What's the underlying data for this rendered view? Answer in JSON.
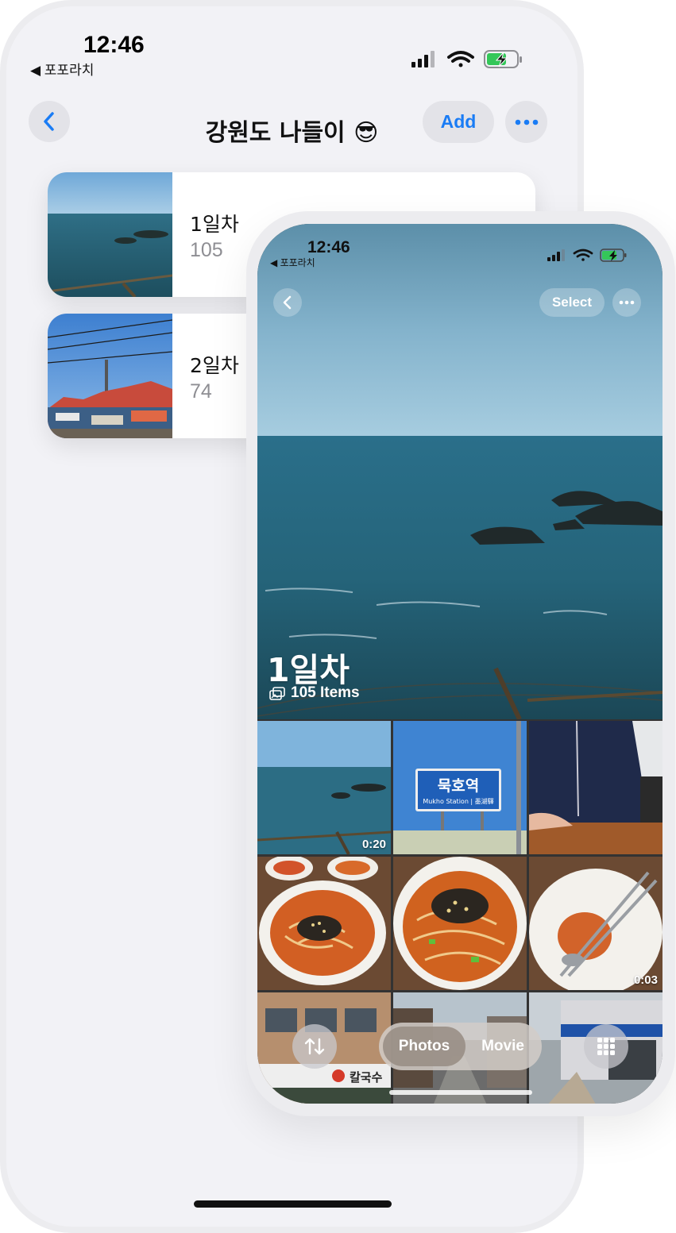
{
  "back_screen": {
    "status": {
      "time": "12:46",
      "back_app": "◀ 포포라치"
    },
    "nav": {
      "title": "강원도 나들이 😎",
      "add_label": "Add"
    },
    "albums": [
      {
        "name": "1일차",
        "count": "105"
      },
      {
        "name": "2일차",
        "count": "74"
      }
    ]
  },
  "front_screen": {
    "status": {
      "time": "12:46",
      "back_app": "◀ 포포라치"
    },
    "nav": {
      "select_label": "Select"
    },
    "hero": {
      "title": "1일차",
      "items": "105 Items"
    },
    "grid": [
      {
        "subject": "sea",
        "duration": "0:20"
      },
      {
        "subject": "station-sign",
        "sign_main": "묵호역",
        "sign_sub": "Mukho Station | 墨湖驛",
        "duration": ""
      },
      {
        "subject": "person-sweater",
        "duration": ""
      },
      {
        "subject": "noodle-soup",
        "duration": ""
      },
      {
        "subject": "noodle-soup",
        "duration": ""
      },
      {
        "subject": "empty-bowl",
        "duration": "0:03"
      },
      {
        "subject": "storefront",
        "sign_text": "칼국수",
        "duration": ""
      },
      {
        "subject": "street",
        "duration": ""
      },
      {
        "subject": "street-shops",
        "duration": ""
      }
    ],
    "segmented": {
      "photos_label": "Photos",
      "movie_label": "Movie",
      "selected": "Photos"
    }
  },
  "colors": {
    "accent": "#1a7cf5",
    "battery": "#34c759"
  }
}
